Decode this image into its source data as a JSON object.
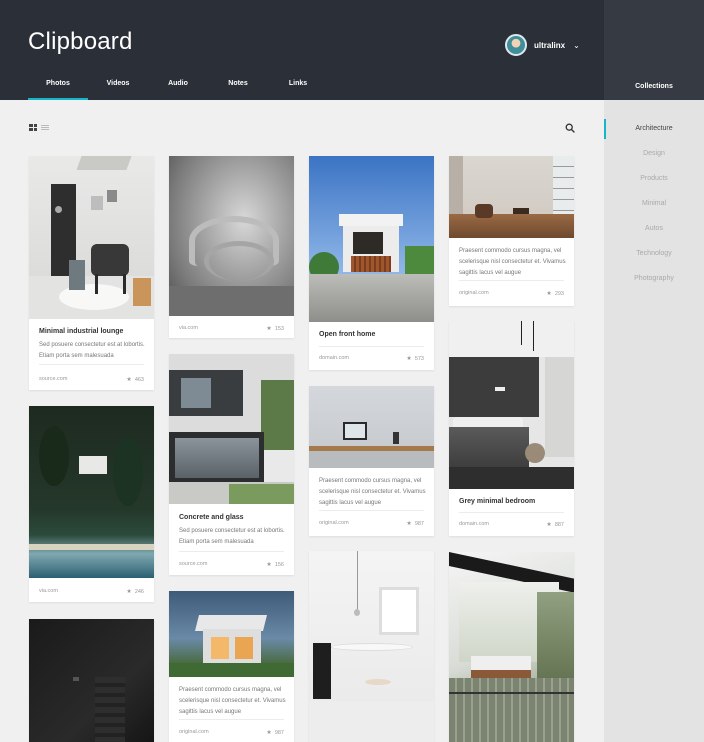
{
  "app": {
    "title": "Clipboard"
  },
  "user": {
    "name": "ultralinx"
  },
  "tabs": [
    "Photos",
    "Videos",
    "Audio",
    "Notes",
    "Links"
  ],
  "sidebar": {
    "title": "Collections",
    "categories": [
      "Architecture",
      "Design",
      "Products",
      "Minimal",
      "Autos",
      "Technology",
      "Photography"
    ]
  },
  "cards": [
    {
      "title": "Minimal industrial lounge",
      "desc": "Sed posuere consectetur est at lobortis. Etiam porta sem malesuada",
      "source": "source.com",
      "count": "463"
    },
    {
      "source": "via.com",
      "count": "246"
    },
    {
      "source": "via.com",
      "count": "153"
    },
    {
      "title": "Concrete and glass",
      "desc": "Sed posuere consectetur est at lobortis. Etiam porta sem malesuada",
      "source": "source.com",
      "count": "156"
    },
    {
      "desc": "Praesent commodo cursus magna, vel scelerisque nisl consectetur et. Vivamus sagittis lacus vel augue",
      "source": "original.com",
      "count": "987"
    },
    {
      "title": "Open front home",
      "source": "domain.com",
      "count": "573"
    },
    {
      "desc": "Praesent commodo cursus magna, vel scelerisque nisl consectetur et. Vivamus sagittis lacus vel augue",
      "source": "original.com",
      "count": "987"
    },
    {
      "desc": "Praesent commodo cursus magna, vel scelerisque nisl consectetur et. Vivamus sagittis lacus vel augue",
      "source": "original.com",
      "count": "293"
    },
    {
      "title": "Grey minimal bedroom",
      "source": "domain.com",
      "count": "887"
    }
  ],
  "colors": {
    "header": "#2b2f38",
    "accent": "#17b5c9",
    "sidebar": "#e3e3e3",
    "content_bg": "#f0f0f0"
  },
  "icons": [
    "grid-view-icon",
    "list-view-icon",
    "search-icon",
    "star-icon",
    "chevron-down-icon"
  ]
}
